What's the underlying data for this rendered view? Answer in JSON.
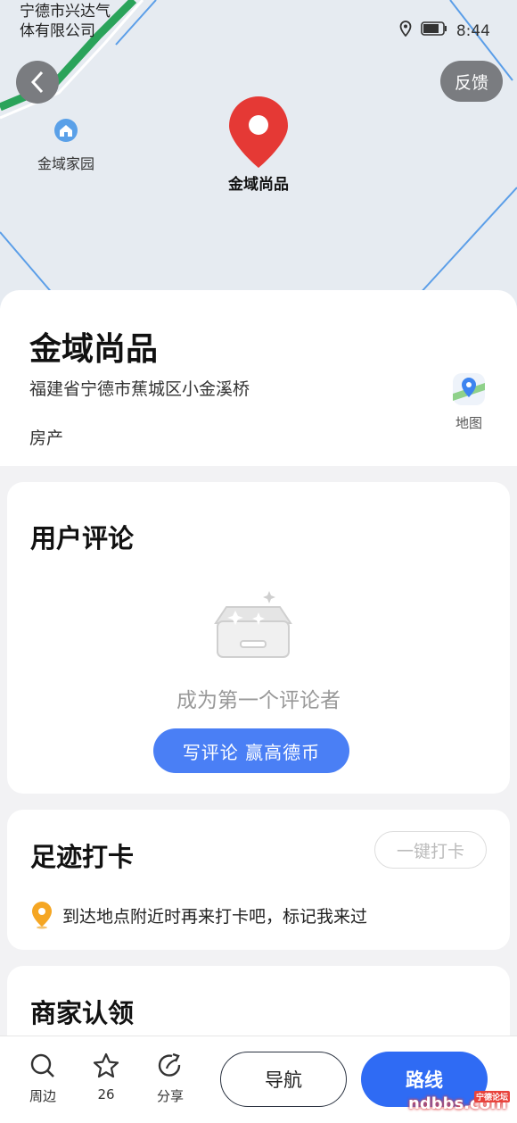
{
  "status_bar": {
    "carrier_line1": "宁德市兴达气",
    "carrier_line2": "体有限公司",
    "time": "8:44"
  },
  "map": {
    "feedback": "反馈",
    "poi_nearby": "金域家园",
    "pin_label": "金域尚品"
  },
  "place": {
    "name": "金域尚品",
    "address": "福建省宁德市蕉城区小金溪桥",
    "category": "房产",
    "map_button": "地图"
  },
  "reviews": {
    "title": "用户评论",
    "empty_text": "成为第一个评论者",
    "cta": "写评论  赢高德币"
  },
  "checkin": {
    "title": "足迹打卡",
    "button": "一键打卡",
    "tip": "到达地点附近时再来打卡吧，标记我来过"
  },
  "merchant": {
    "title": "商家认领"
  },
  "bottom_bar": {
    "nearby": "周边",
    "favorites": "26",
    "share": "分享",
    "navigate": "导航",
    "route": "路线"
  },
  "watermark": {
    "text": "ndbbs.com",
    "sub": "宁德论坛"
  },
  "colors": {
    "accent": "#2f6bf4",
    "cta": "#4a7ff5",
    "pin": "#e53935",
    "road": "#2aa35a"
  }
}
